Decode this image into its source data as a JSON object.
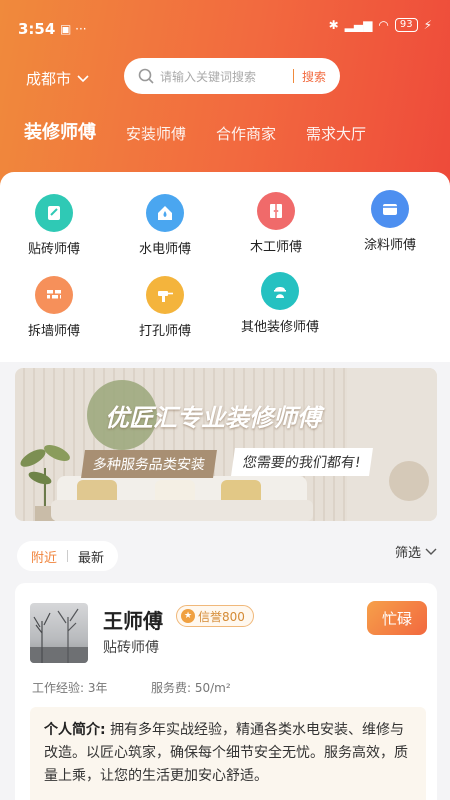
{
  "status": {
    "time": "3:54",
    "battery": "93"
  },
  "header": {
    "city": "成都市",
    "search_placeholder": "请输入关键词搜索",
    "search_button": "搜索",
    "tabs": [
      "装修师傅",
      "安装师傅",
      "合作商家",
      "需求大厅"
    ]
  },
  "categories": [
    {
      "label": "贴砖师傅",
      "icon": "tile-icon",
      "color": "#2fc9b5"
    },
    {
      "label": "水电师傅",
      "icon": "plumbing-icon",
      "color": "#4aa6f0"
    },
    {
      "label": "木工师傅",
      "icon": "wardrobe-icon",
      "color": "#f06a6a"
    },
    {
      "label": "涂料师傅",
      "icon": "paint-icon",
      "color": "#4d8ff0"
    },
    {
      "label": "拆墙师傅",
      "icon": "brick-wall-icon",
      "color": "#f6905a"
    },
    {
      "label": "打孔师傅",
      "icon": "drill-icon",
      "color": "#f4b43c"
    },
    {
      "label": "其他装修师傅",
      "icon": "worker-icon",
      "color": "#25c1c1"
    }
  ],
  "banner": {
    "title": "优匠汇专业装修师傅",
    "tag1": "多种服务品类安装",
    "tag2": "您需要的我们都有!"
  },
  "filter": {
    "near": "附近",
    "latest": "最新",
    "filter_label": "筛选"
  },
  "worker": {
    "name": "王师傅",
    "credit": "信誉800",
    "trade": "贴砖师傅",
    "status": "忙碌",
    "experience": "工作经验: 3年",
    "fee": "服务费: 50/m²",
    "bio_label": "个人简介:",
    "bio_text": "拥有多年实战经验，精通各类水电安装、维修与改造。以匠心筑家，确保每个细节安全无忧。服务高效，质量上乘，让您的生活更加安心舒适。"
  }
}
